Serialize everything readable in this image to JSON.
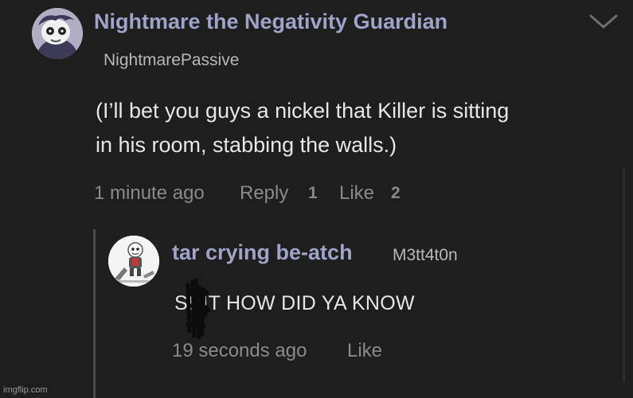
{
  "comment": {
    "author": "Nightmare the Negativity Guardian",
    "username": "NightmarePassive",
    "text_line1": "(I’ll bet you guys a nickel that Killer is sitting",
    "text_line2": "in his room, stabbing the walls.)",
    "time": "1 minute ago",
    "reply_label": "Reply",
    "reply_count": "1",
    "like_label": "Like",
    "like_count": "2"
  },
  "reply": {
    "author": "tar crying be-atch",
    "username": "M3tt4t0n",
    "text": "SHIT HOW DID YA KNOW",
    "time": "19 seconds ago",
    "like_label": "Like"
  },
  "watermark": "imgflip.com",
  "icons": {
    "expand": "chevron-down-icon",
    "censor": "scribble-censor"
  },
  "colors": {
    "background": "#1e1e1e",
    "author_name": "#9fa3c8",
    "body_text": "#e6e6e6",
    "meta_text": "#8a8a8a"
  }
}
